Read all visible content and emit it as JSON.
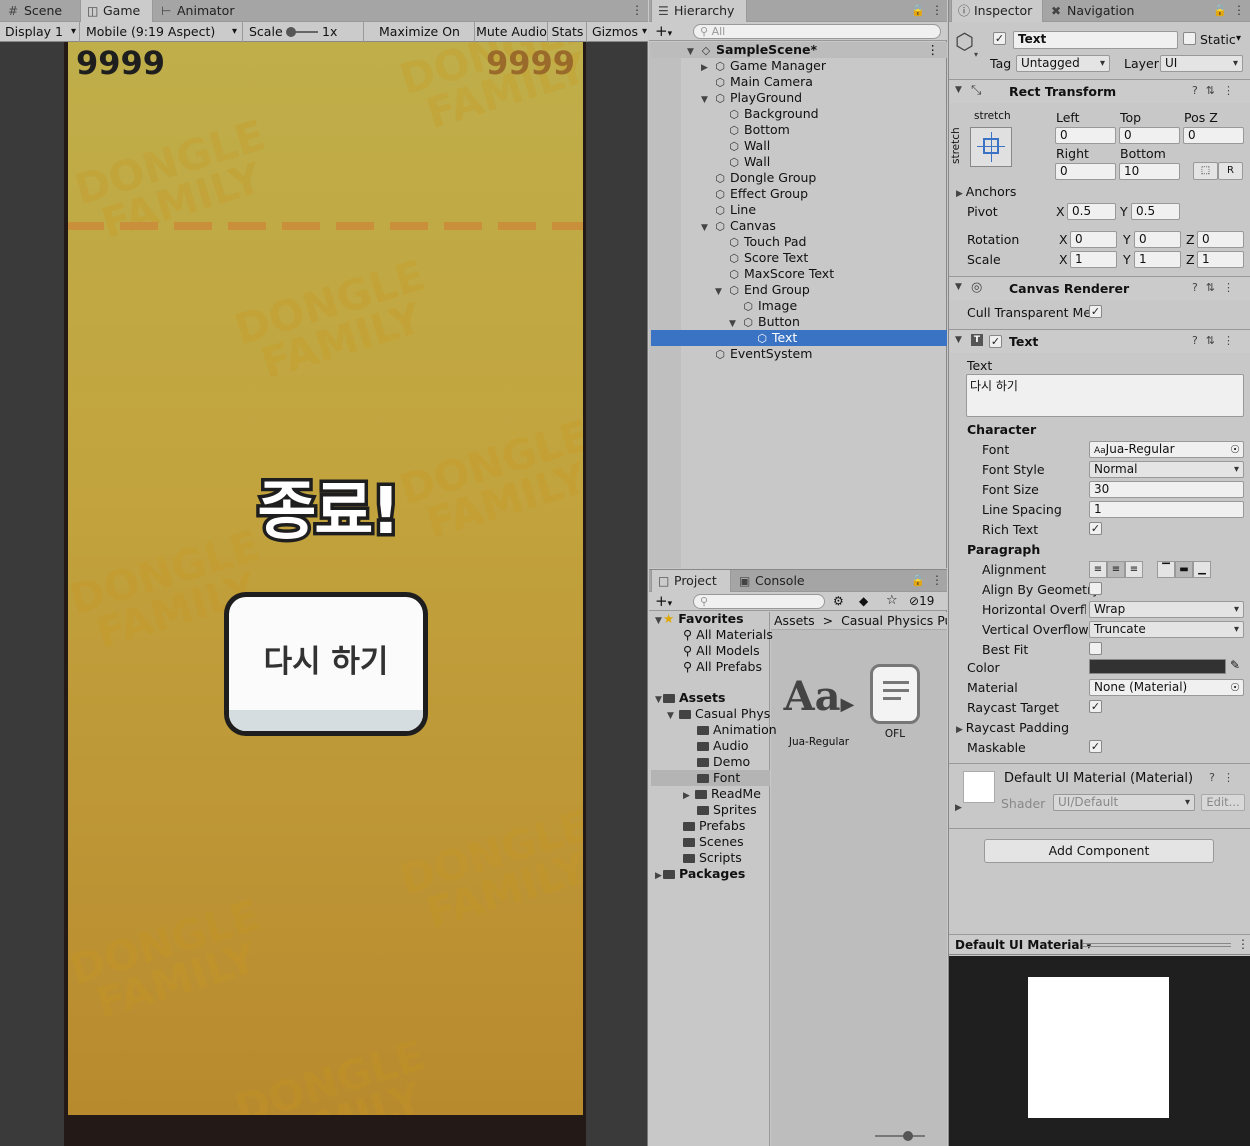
{
  "colors": {
    "editor_bg": "#c8c8c8",
    "selection": "#3a73c4",
    "game_top": "#bfae4a",
    "game_bottom": "#b88a2e",
    "dashed_line": "#c98f3a"
  },
  "game_view": {
    "tabs": [
      {
        "label": "Scene",
        "icon": "grid-icon"
      },
      {
        "label": "Game",
        "icon": "gamepad-icon"
      },
      {
        "label": "Animator",
        "icon": "animator-icon"
      }
    ],
    "toolbar": {
      "display": "Display 1",
      "aspect": "Mobile (9:19 Aspect)",
      "scale_label": "Scale",
      "scale_value": "1x",
      "maximize": "Maximize On Play",
      "mute": "Mute Audio",
      "stats": "Stats",
      "gizmos": "Gizmos"
    },
    "score": "9999",
    "max_score": "9999",
    "end_title": "종료!",
    "retry_label": "다시 하기",
    "watermark_line1": "DONGLE",
    "watermark_line2": "FAMILY"
  },
  "hierarchy": {
    "tab": "Hierarchy",
    "search_placeholder": "All",
    "items": [
      {
        "label": "SampleScene*",
        "depth": 0,
        "expanded": true,
        "icon": "unity-scene-icon",
        "bold": true
      },
      {
        "label": "Game Manager",
        "depth": 1,
        "expandable": true,
        "icon": "gameobject-icon"
      },
      {
        "label": "Main Camera",
        "depth": 1,
        "icon": "gameobject-icon"
      },
      {
        "label": "PlayGround",
        "depth": 1,
        "expanded": true,
        "icon": "gameobject-icon"
      },
      {
        "label": "Background",
        "depth": 2,
        "icon": "gameobject-icon"
      },
      {
        "label": "Bottom",
        "depth": 2,
        "icon": "gameobject-icon"
      },
      {
        "label": "Wall",
        "depth": 2,
        "icon": "gameobject-icon"
      },
      {
        "label": "Wall",
        "depth": 2,
        "icon": "gameobject-icon"
      },
      {
        "label": "Dongle Group",
        "depth": 1,
        "icon": "gameobject-icon"
      },
      {
        "label": "Effect Group",
        "depth": 1,
        "icon": "gameobject-icon"
      },
      {
        "label": "Line",
        "depth": 1,
        "icon": "gameobject-icon"
      },
      {
        "label": "Canvas",
        "depth": 1,
        "expanded": true,
        "icon": "gameobject-icon"
      },
      {
        "label": "Touch Pad",
        "depth": 2,
        "icon": "gameobject-icon"
      },
      {
        "label": "Score Text",
        "depth": 2,
        "icon": "gameobject-icon"
      },
      {
        "label": "MaxScore Text",
        "depth": 2,
        "icon": "gameobject-icon"
      },
      {
        "label": "End Group",
        "depth": 2,
        "expanded": true,
        "icon": "gameobject-icon"
      },
      {
        "label": "Image",
        "depth": 3,
        "icon": "gameobject-icon"
      },
      {
        "label": "Button",
        "depth": 3,
        "expanded": true,
        "icon": "gameobject-icon"
      },
      {
        "label": "Text",
        "depth": 4,
        "icon": "gameobject-icon",
        "selected": true
      },
      {
        "label": "EventSystem",
        "depth": 1,
        "icon": "gameobject-icon"
      }
    ]
  },
  "project": {
    "tabs": [
      {
        "label": "Project",
        "icon": "folder-icon"
      },
      {
        "label": "Console",
        "icon": "console-icon"
      }
    ],
    "hidden_count": "19",
    "favorites_label": "Favorites",
    "favorites": [
      "All Materials",
      "All Models",
      "All Prefabs"
    ],
    "assets_label": "Assets",
    "tree": [
      {
        "label": "Casual Phys",
        "depth": 1,
        "expanded": true
      },
      {
        "label": "Animation",
        "depth": 2
      },
      {
        "label": "Audio",
        "depth": 2
      },
      {
        "label": "Demo",
        "depth": 2
      },
      {
        "label": "Font",
        "depth": 2,
        "selected": true
      },
      {
        "label": "ReadMe",
        "depth": 2,
        "expandable": true
      },
      {
        "label": "Sprites",
        "depth": 2
      },
      {
        "label": "Prefabs",
        "depth": 1
      },
      {
        "label": "Scenes",
        "depth": 1
      },
      {
        "label": "Scripts",
        "depth": 1
      }
    ],
    "packages_label": "Packages",
    "breadcrumb": [
      "Assets",
      "Casual Physics Puzz"
    ],
    "files": [
      {
        "name": "Jua-Regular",
        "icon": "font-asset-icon"
      },
      {
        "name": "OFL",
        "icon": "text-asset-icon"
      }
    ]
  },
  "inspector": {
    "tabs": [
      {
        "label": "Inspector",
        "icon": "info-icon"
      },
      {
        "label": "Navigation",
        "icon": "navigation-icon"
      }
    ],
    "object_name": "Text",
    "static_label": "Static",
    "tag_label": "Tag",
    "tag_value": "Untagged",
    "layer_label": "Layer",
    "layer_value": "UI",
    "rect_transform": {
      "title": "Rect Transform",
      "anchor_h": "stretch",
      "anchor_v": "stretch",
      "left_label": "Left",
      "left": "0",
      "top_label": "Top",
      "top": "0",
      "posz_label": "Pos Z",
      "posz": "0",
      "right_label": "Right",
      "right": "0",
      "bottom_label": "Bottom",
      "bottom": "10",
      "r_button": "R",
      "anchors_label": "Anchors",
      "pivot_label": "Pivot",
      "pivot_x": "0.5",
      "pivot_y": "0.5",
      "rotation_label": "Rotation",
      "rot_x": "0",
      "rot_y": "0",
      "rot_z": "0",
      "scale_label": "Scale",
      "scale_x": "1",
      "scale_y": "1",
      "scale_z": "1"
    },
    "canvas_renderer": {
      "title": "Canvas Renderer",
      "cull_label": "Cull Transparent Mes"
    },
    "text_component": {
      "title": "Text",
      "text_label": "Text",
      "text_value": "다시 하기",
      "character_label": "Character",
      "font_label": "Font",
      "font_value": "Jua-Regular",
      "font_style_label": "Font Style",
      "font_style_value": "Normal",
      "font_size_label": "Font Size",
      "font_size_value": "30",
      "line_spacing_label": "Line Spacing",
      "line_spacing_value": "1",
      "rich_text_label": "Rich Text",
      "paragraph_label": "Paragraph",
      "alignment_label": "Alignment",
      "align_geom_label": "Align By Geometry",
      "h_overflow_label": "Horizontal Overflov",
      "h_overflow_value": "Wrap",
      "v_overflow_label": "Vertical Overflow",
      "v_overflow_value": "Truncate",
      "best_fit_label": "Best Fit",
      "color_label": "Color",
      "color_value": "#323232",
      "material_label": "Material",
      "material_value": "None (Material)",
      "raycast_target_label": "Raycast Target",
      "raycast_padding_label": "Raycast Padding",
      "maskable_label": "Maskable"
    },
    "material": {
      "title": "Default UI Material (Material)",
      "shader_label": "Shader",
      "shader_value": "UI/Default",
      "edit_label": "Edit..."
    },
    "add_component": "Add Component",
    "preview_title": "Default UI Material"
  }
}
